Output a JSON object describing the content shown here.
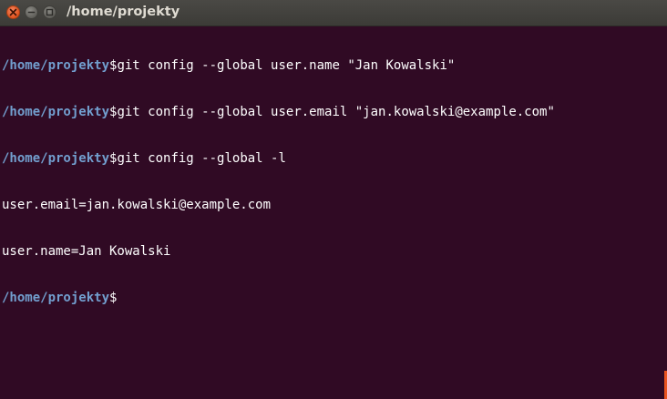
{
  "window": {
    "title": "/home/projekty"
  },
  "terminal": {
    "lines": [
      {
        "prompt": "/home/projekty",
        "symbol": "$",
        "command": "git config --global user.name \"Jan Kowalski\""
      },
      {
        "prompt": "/home/projekty",
        "symbol": "$",
        "command": "git config --global user.email \"jan.kowalski@example.com\""
      },
      {
        "prompt": "/home/projekty",
        "symbol": "$",
        "command": "git config --global -l"
      },
      {
        "output": "user.email=jan.kowalski@example.com"
      },
      {
        "output": "user.name=Jan Kowalski"
      },
      {
        "prompt": "/home/projekty",
        "symbol": "$",
        "command": ""
      }
    ]
  },
  "colors": {
    "background": "#300a24",
    "prompt": "#729fcf",
    "text": "#ffffff",
    "close_button": "#e0541f",
    "accent": "#e95420"
  },
  "icons": {
    "close": "close-icon",
    "minimize": "minimize-icon",
    "maximize": "maximize-icon"
  }
}
